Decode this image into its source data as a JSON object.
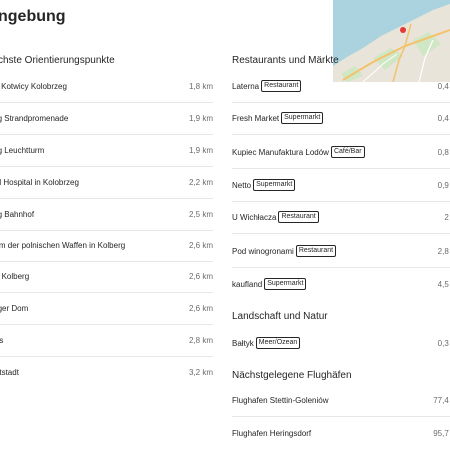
{
  "page": {
    "title": "ngebung"
  },
  "map_colors": {
    "sea": "#aad3df",
    "land": "#e8e4da",
    "green": "#cfe7c4",
    "road": "#f4c26a",
    "pin": "#e53935"
  },
  "landmarks": {
    "title": "chste Orientierungspunkte",
    "items": [
      {
        "name": "tion Kotwicy Kolobrzeg",
        "distance": "1,8 km"
      },
      {
        "name": "berg Strandpromenade",
        "distance": "1,9 km"
      },
      {
        "name": "berg Leuchtturm",
        "distance": "1,9 km"
      },
      {
        "name": "onal Hospital in Kolobrzeg",
        "distance": "2,2 km"
      },
      {
        "name": "berg Bahnhof",
        "distance": "2,5 km"
      },
      {
        "name": "seum der polnischen Waffen in Kolberg",
        "distance": "2,6 km"
      },
      {
        "name": "ung Kolberg",
        "distance": "2,6 km"
      },
      {
        "name": "berger Dom",
        "distance": "2,6 km"
      },
      {
        "name": "haus",
        "distance": "2,8 km"
      },
      {
        "name": "e Altstadt",
        "distance": "3,2 km"
      }
    ]
  },
  "restaurants": {
    "title": "Restaurants und Märkte",
    "items": [
      {
        "name": "Laterna",
        "tag": "Restaurant",
        "distance": "0,4 k"
      },
      {
        "name": "Fresh Market",
        "tag": "Supermarkt",
        "distance": "0,4 k"
      },
      {
        "name": "Kupiec Manufaktura Lodów",
        "tag": "Café/Bar",
        "distance": "0,8 k"
      },
      {
        "name": "Netto",
        "tag": "Supermarkt",
        "distance": "0,9 k"
      },
      {
        "name": "U Wichłacza",
        "tag": "Restaurant",
        "distance": "2 k"
      },
      {
        "name": "Pod winogronami",
        "tag": "Restaurant",
        "distance": "2,8 k"
      },
      {
        "name": "kaufland",
        "tag": "Supermarkt",
        "distance": "4,5 k"
      }
    ]
  },
  "nature": {
    "title": "Landschaft und Natur",
    "items": [
      {
        "name": "Bałtyk",
        "tag": "Meer/Ozean",
        "distance": "0,3 k"
      }
    ]
  },
  "airports": {
    "title": "Nächstgelegene Flughäfen",
    "items": [
      {
        "name": "Flughafen Stettin-Goleniów",
        "distance": "77,4 k"
      },
      {
        "name": "Flughafen Heringsdorf",
        "distance": "95,7 k"
      }
    ]
  }
}
